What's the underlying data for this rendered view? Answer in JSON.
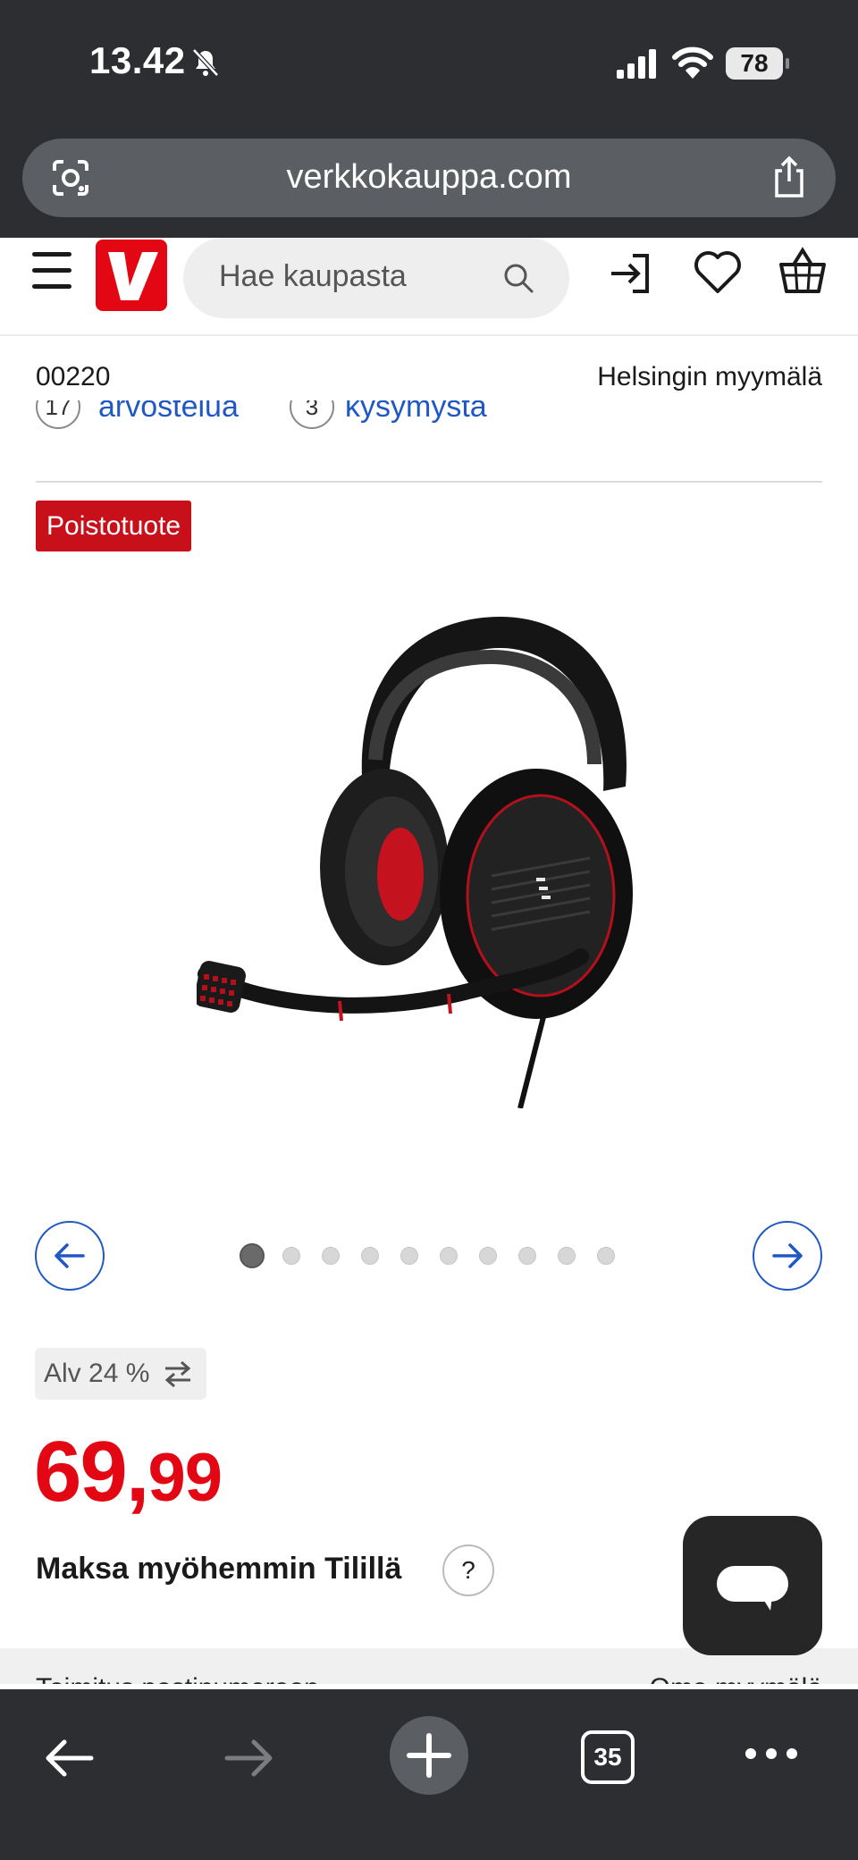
{
  "status_bar": {
    "time": "13.42",
    "battery": "78"
  },
  "browser": {
    "url": "verkkokauppa.com",
    "tabs_count": "35"
  },
  "site_header": {
    "search_placeholder": "Hae kaupasta"
  },
  "location": {
    "postal_code": "00220",
    "store": "Helsingin myymälä"
  },
  "reviews": {
    "review_count": "17",
    "review_label": "arvostelua",
    "question_count": "3",
    "question_label": "kysymystä"
  },
  "product": {
    "badge": "Poistotuote",
    "image_alt": "EPOS Sennheiser gaming headset",
    "carousel": {
      "total": 10,
      "active_index": 0
    },
    "vat_label": "Alv 24 %",
    "price_int": "69,",
    "price_dec": "99",
    "pay_later_label": "Maksa myöhemmin Tilillä",
    "help_label": "?"
  },
  "delivery": {
    "left_label": "Toimitus postinumeroon",
    "right_label": "Oma myymälä"
  },
  "colors": {
    "brand_red": "#e30613",
    "link_blue": "#1f58c5",
    "chrome_dark": "#2c2e31"
  }
}
